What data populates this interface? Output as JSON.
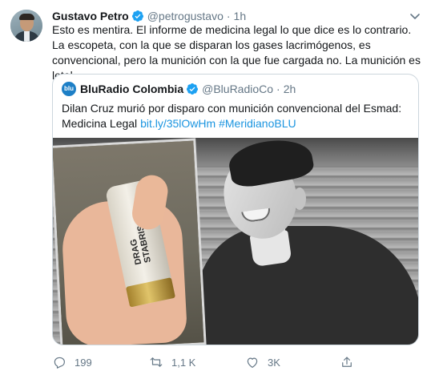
{
  "tweet": {
    "display_name": "Gustavo Petro",
    "handle": "@petrogustavo",
    "separator": "·",
    "time": "1h",
    "text": "Esto es mentira. El informe de medicina legal lo que dice es lo contrario. La escopeta, con la que se disparan los gases lacrimógenos, es convencional, pero la munición con la que fue cargada no. La munición es letal",
    "colors": {
      "verified": "#1da1f2",
      "secondary": "#657786",
      "link": "#1b95e0"
    }
  },
  "quoted": {
    "display_name": "BluRadio Colombia",
    "handle": "@BluRadioCo",
    "separator": "·",
    "time": "2h",
    "avatar_text": "blu",
    "text_main": "Dilan Cruz murió por disparo con munición convencional del Esmad: Medicina Legal ",
    "link": "bit.ly/35lOwHm",
    "hashtag": " #MeridianoBLU",
    "shell_label": "DRAG STABRIS"
  },
  "actions": {
    "reply": {
      "icon": "reply-icon",
      "count": "199"
    },
    "retweet": {
      "icon": "retweet-icon",
      "count": "1,1 K"
    },
    "like": {
      "icon": "heart-icon",
      "count": "3K"
    },
    "share": {
      "icon": "share-icon"
    }
  }
}
